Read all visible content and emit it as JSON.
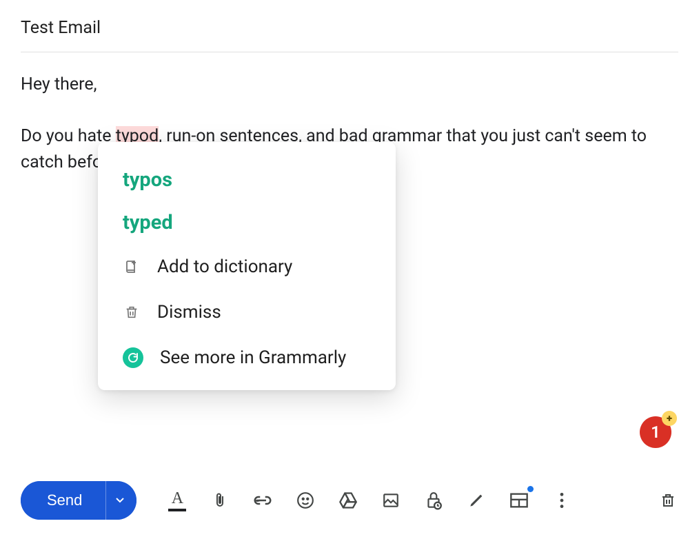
{
  "compose": {
    "subject": "Test Email",
    "body_pre": "Hey there,",
    "body_line_prefix": "Do you hate ",
    "typo_word": "typod",
    "body_line_mid": ", run-on sentences, and bad grammar that you just can't seem to",
    "body_line_wrap": "catch befo"
  },
  "grammarly_popup": {
    "suggestions": [
      "typos",
      "typed"
    ],
    "add_dictionary_label": "Add to dictionary",
    "dismiss_label": "Dismiss",
    "see_more_label": "See more in Grammarly"
  },
  "error_badge": {
    "count": "1",
    "plus": "+"
  },
  "toolbar": {
    "send_label": "Send",
    "format_letter": "A",
    "icons": {
      "attach": "paperclip-icon",
      "link": "link-icon",
      "emoji": "emoji-icon",
      "drive": "drive-icon",
      "image": "image-icon",
      "confidential": "lock-clock-icon",
      "signature": "pen-icon",
      "layout": "layout-icon",
      "more": "more-vertical-icon",
      "discard": "trash-icon"
    }
  }
}
